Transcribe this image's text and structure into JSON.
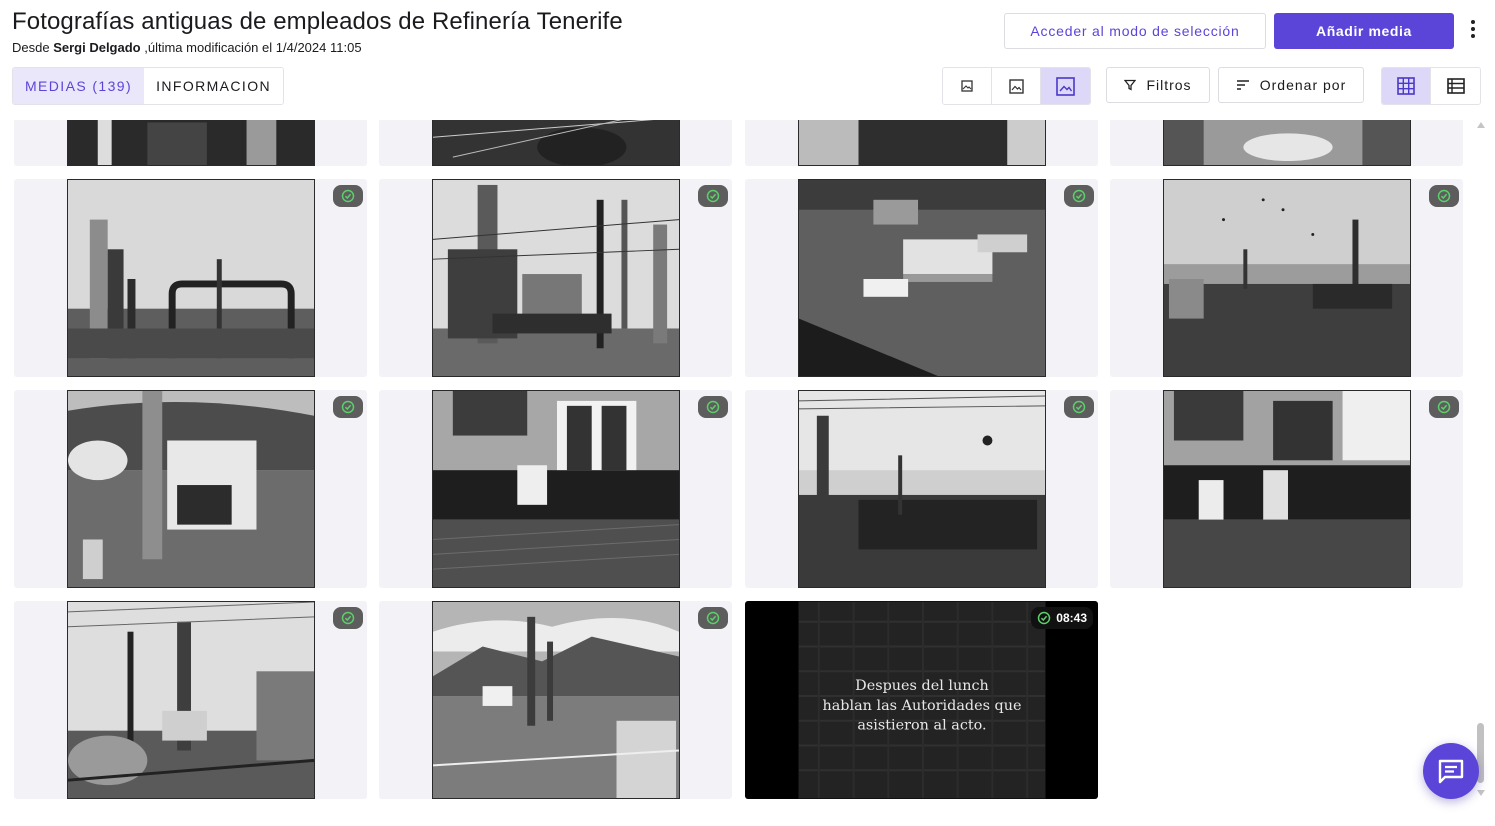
{
  "header": {
    "title": "Fotografías antiguas de empleados de Refinería Tenerife",
    "subtitle_prefix": "Desde",
    "author": "Sergi Delgado",
    "subtitle_middle": ",última modificación el",
    "modified": "1/4/2024 11:05",
    "select_mode_label": "Acceder al modo de selección",
    "add_media_label": "Añadir media"
  },
  "tabs": [
    {
      "label": "MEDIAS (139)",
      "active": true
    },
    {
      "label": "INFORMACION",
      "active": false
    }
  ],
  "toolbar": {
    "size_options": [
      "small-image-icon",
      "medium-image-icon",
      "large-image-icon"
    ],
    "size_selected": "large",
    "filters_label": "Filtros",
    "sort_label": "Ordenar por",
    "view_options": [
      "grid-view-icon",
      "list-view-icon"
    ],
    "view_selected": "grid"
  },
  "media": {
    "items": [
      {
        "type": "image",
        "status": "processed"
      },
      {
        "type": "image",
        "status": "processed"
      },
      {
        "type": "image",
        "status": "processed"
      },
      {
        "type": "image",
        "status": "processed"
      },
      {
        "type": "image",
        "status": "processed"
      },
      {
        "type": "image",
        "status": "processed"
      },
      {
        "type": "image",
        "status": "processed"
      },
      {
        "type": "image",
        "status": "processed"
      },
      {
        "type": "image",
        "status": "processed"
      },
      {
        "type": "image",
        "status": "processed"
      },
      {
        "type": "image",
        "status": "processed"
      },
      {
        "type": "image",
        "status": "processed"
      },
      {
        "type": "image",
        "status": "processed"
      },
      {
        "type": "image",
        "status": "processed"
      },
      {
        "type": "video",
        "status": "processed",
        "duration": "08:43",
        "caption_lines": [
          "Despues del lunch",
          "hablan las Autoridades que",
          "asistieron al acto."
        ]
      }
    ]
  },
  "colors": {
    "accent": "#5b45d9",
    "accent_light": "#ebe7fb",
    "status_ok": "#5ccf6a",
    "badge_bg": "#5d5d5d"
  }
}
